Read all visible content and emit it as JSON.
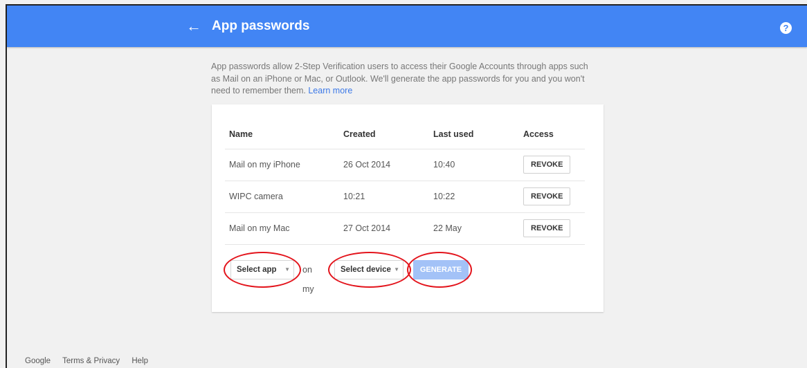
{
  "header": {
    "back_icon": "arrow-back-icon",
    "title": "App passwords",
    "help_icon": "help-circle-icon",
    "help_glyph": "?",
    "accent": "#4285f4"
  },
  "intro": {
    "text": "App passwords allow 2-Step Verification users to access their Google Accounts through apps such as Mail on an iPhone or Mac, or Outlook. We'll generate the app passwords for you and you won't need to remember them.",
    "learn_more": "Learn more"
  },
  "table": {
    "headers": [
      "Name",
      "Created",
      "Last used",
      "Access"
    ],
    "rows": [
      {
        "name": "Mail on my iPhone",
        "created": "26 Oct 2014",
        "last_used": "10:40",
        "action": "REVOKE"
      },
      {
        "name": "WIPC camera",
        "created": "10:21",
        "last_used": "10:22",
        "action": "REVOKE"
      },
      {
        "name": "Mail on my Mac",
        "created": "27 Oct 2014",
        "last_used": "22 May",
        "action": "REVOKE"
      }
    ]
  },
  "controls": {
    "select_app": "Select app",
    "on_my": "on my",
    "select_device": "Select device",
    "generate": "GENERATE",
    "annotation_color": "#e3141c"
  },
  "footer": {
    "links": [
      "Google",
      "Terms & Privacy",
      "Help"
    ]
  }
}
